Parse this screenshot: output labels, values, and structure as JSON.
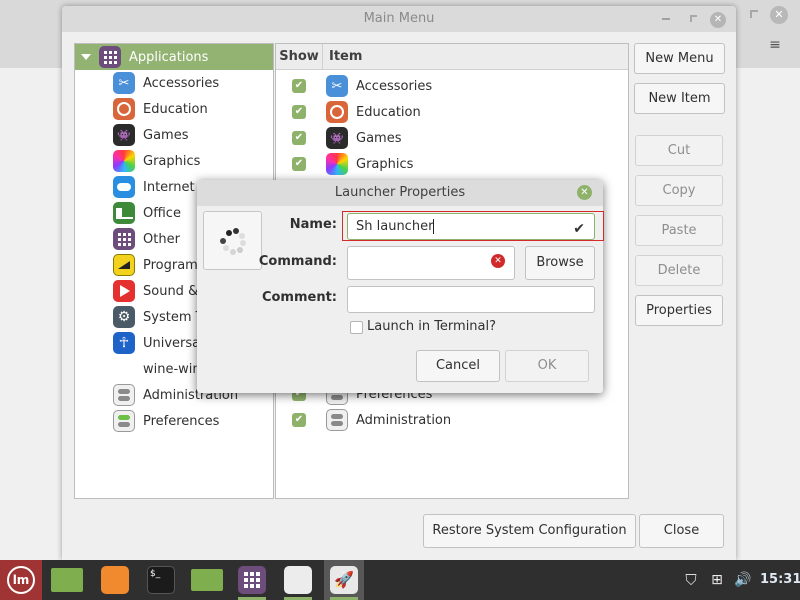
{
  "main_window": {
    "title": "Main Menu",
    "tree": {
      "root": {
        "label": "Applications",
        "icon": "applications-grid-icon",
        "expanded": true,
        "selected": true
      },
      "children": [
        {
          "label": "Accessories",
          "icon": "scissors-icon"
        },
        {
          "label": "Education",
          "icon": "education-icon"
        },
        {
          "label": "Games",
          "icon": "invader-icon"
        },
        {
          "label": "Graphics",
          "icon": "color-gradient-icon"
        },
        {
          "label": "Internet",
          "icon": "cloud-icon"
        },
        {
          "label": "Office",
          "icon": "document-icon"
        },
        {
          "label": "Other",
          "icon": "grid-icon"
        },
        {
          "label": "Programming",
          "icon": "ruler-icon"
        },
        {
          "label": "Sound & Video",
          "icon": "play-icon"
        },
        {
          "label": "System Tools",
          "icon": "gear-icon"
        },
        {
          "label": "Universal Access",
          "icon": "accessibility-icon"
        },
        {
          "label": "wine-wine",
          "icon": ""
        },
        {
          "label": "Administration",
          "icon": "toggle-switches-icon"
        },
        {
          "label": "Preferences",
          "icon": "toggle-switches-green-icon"
        }
      ]
    },
    "items_table": {
      "columns": [
        "Show",
        "Item"
      ],
      "rows": [
        {
          "show": true,
          "label": "Accessories",
          "icon": "scissors-icon"
        },
        {
          "show": true,
          "label": "Education",
          "icon": "education-icon"
        },
        {
          "show": true,
          "label": "Games",
          "icon": "invader-icon"
        },
        {
          "show": true,
          "label": "Graphics",
          "icon": "color-gradient-icon"
        },
        {
          "show": true,
          "label": "Preferences",
          "icon": "toggle-switches-icon"
        },
        {
          "show": true,
          "label": "Administration",
          "icon": "toggle-switches-icon"
        }
      ]
    },
    "buttons": {
      "new_menu": "New Menu",
      "new_item": "New Item",
      "cut": "Cut",
      "copy": "Copy",
      "paste": "Paste",
      "delete": "Delete",
      "properties": "Properties",
      "restore": "Restore System Configuration",
      "close": "Close"
    }
  },
  "dialog": {
    "title": "Launcher Properties",
    "name_label": "Name:",
    "name_value": "Sh launcher",
    "command_label": "Command:",
    "command_value": "",
    "browse": "Browse",
    "comment_label": "Comment:",
    "comment_value": "",
    "terminal_label": "Launch in Terminal?",
    "terminal_checked": false,
    "cancel": "Cancel",
    "ok": "OK"
  },
  "taskbar": {
    "apps": [
      "menu",
      "show-desktop",
      "firefox",
      "terminal",
      "files",
      "main-menu-editor",
      "notes",
      "launcher"
    ],
    "clock": "15:31",
    "accent": "#8fb26b"
  },
  "colors": {
    "selection": "#92b372",
    "highlight": "#d62a2a",
    "taskbar_bg": "#2f2f2f"
  }
}
